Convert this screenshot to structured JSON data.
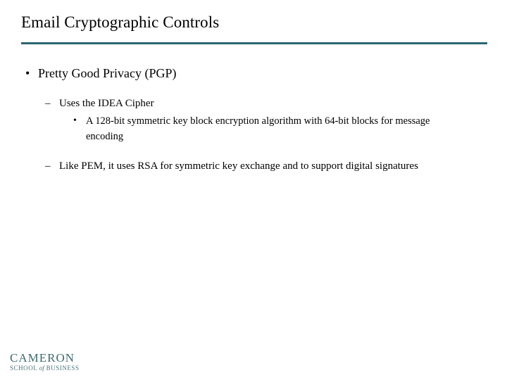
{
  "slide": {
    "title": "Email Cryptographic Controls",
    "background_color": "#ffffff",
    "rule_color": "#2a6670",
    "text_color": "#000000"
  },
  "content": {
    "level1": [
      {
        "marker": "•",
        "text": "Pretty Good Privacy (PGP)"
      }
    ],
    "level2": [
      {
        "marker": "–",
        "text": "Uses the IDEA Cipher"
      },
      {
        "marker": "–",
        "text": "Like PEM, it uses RSA for symmetric key exchange and to support digital signatures"
      }
    ],
    "level3": [
      {
        "marker": "•",
        "text": "A 128-bit symmetric key block encryption algorithm with 64-bit blocks for message encoding"
      }
    ]
  },
  "logo": {
    "name": "CAMERON",
    "sub_first": "SCHOOL",
    "sub_of": "of",
    "sub_last": "BUSINESS",
    "color": "#3d6b70"
  }
}
